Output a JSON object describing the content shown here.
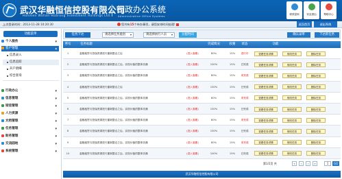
{
  "header": {
    "company_cn": "武汉华融恒信控股有限公司",
    "company_en": "Hanmen Wuhan Huarong Investment Holdings Ltd.",
    "system_cn": "行政办公系统",
    "system_en": "Administrative Office Systems",
    "buttons": [
      {
        "label": "修改密码",
        "icon": "key-icon"
      },
      {
        "label": "安全退出",
        "icon": "power-icon"
      },
      {
        "label": "帮助中心",
        "icon": "help-icon"
      }
    ]
  },
  "statusbar": {
    "login_info": "上次登录时间：2013-11-28 10:20:30",
    "notice_prefix": "您共有",
    "notice_count": "15",
    "notice_suffix": "个待办事项，请您安排时间处理!",
    "home_label": "返回首页",
    "exit_label": "退出系统"
  },
  "sidebar": {
    "heading": "功能菜单",
    "items": [
      {
        "label": "个人服务",
        "color": "#2f8bd6"
      },
      {
        "label": "客户管理",
        "color": "#e6a124",
        "expanded": true
      },
      {
        "label": "行政办公",
        "color": "#3c9a4a"
      },
      {
        "label": "信息管理",
        "color": "#2f8bd6"
      },
      {
        "label": "短信管理",
        "color": "#3c9a4a"
      },
      {
        "label": "人力资源",
        "color": "#e6a124"
      },
      {
        "label": "文档管理",
        "color": "#2f8bd6"
      },
      {
        "label": "任务管理",
        "color": "#3c9a4a"
      },
      {
        "label": "财务管理",
        "color": "#e34a3c"
      },
      {
        "label": "交流园地",
        "color": "#2f8bd6"
      },
      {
        "label": "系统管理",
        "color": "#e34a3c"
      }
    ],
    "sub_items": [
      "信息录入",
      "信息追踪",
      "开户明细",
      "综合查询"
    ]
  },
  "toolbar": {
    "title": "任务下达",
    "category_placeholder": "请选择任务类别",
    "person_placeholder": "请选择执行人员",
    "assign_label": "分配时间",
    "confirm_label": "确认录单",
    "next_label": "下达新任务"
  },
  "table": {
    "headers": [
      "序号",
      "任务标题",
      "完成情况",
      "权重",
      "状态",
      "功能"
    ],
    "urgent_tag": "(进入查看)",
    "actions": {
      "view": "查看任务详情",
      "edit": "修改任务",
      "delete": "删除任务"
    },
    "rows": [
      {
        "no": "1",
        "title": "金融租赁与担保资源进行重新整合之后",
        "progress": "80%",
        "weight": "15%",
        "status": "进行中",
        "status_type": "red"
      },
      {
        "no": "2",
        "title": "金融租赁与担保资源进行重新整合之后，实现价值的整体流通",
        "progress": "100%",
        "weight": "15%",
        "status": "已完成",
        "status_type": "gray"
      },
      {
        "no": "3",
        "title": "金融租赁与担保资源进行重新整合之后，实现价值的整体流通",
        "progress": "80%",
        "weight": "15%",
        "status": "未完成",
        "status_type": "red"
      },
      {
        "no": "4",
        "title": "金融租赁与担保资源进行重新整合之后",
        "progress": "100%",
        "weight": "15%",
        "status": "已完成",
        "status_type": "gray"
      },
      {
        "no": "5",
        "title": "金融租赁与担保资源进行重新整合之后，实现价值的整体流通",
        "progress": "80%",
        "weight": "15%",
        "status": "未完成",
        "status_type": "red"
      },
      {
        "no": "6",
        "title": "金融租赁与担保资源进行重新整合之后，实现价值的整体流通",
        "progress": "100%",
        "weight": "15%",
        "status": "已完成",
        "status_type": "gray"
      },
      {
        "no": "7",
        "title": "金融租赁与担保资源进行重新整合之后，实现价值的整体流通",
        "progress": "80%",
        "weight": "15%",
        "status": "未完成",
        "status_type": "red"
      },
      {
        "no": "8",
        "title": "金融租赁与担保资源进行重新整合之后，实现价值的整体流通",
        "progress": "100%",
        "weight": "15%",
        "status": "已完成",
        "status_type": "gray"
      },
      {
        "no": "9",
        "title": "金融租赁与担保资源进行重新整合之后，实现价值的整体流通",
        "progress": "80%",
        "weight": "15%",
        "status": "未完成",
        "status_type": "red"
      },
      {
        "no": "10",
        "title": "金融租赁与担保资源进行重新整合之后，实现价值的整体流通",
        "progress": "100%",
        "weight": "15%",
        "status": "已完成",
        "status_type": "gray"
      }
    ]
  },
  "pager": {
    "info": "第1/2页 共",
    "input_value": "1",
    "go_label": "GO"
  },
  "footer": {
    "text": "武汉华融恒信控股有限公司"
  }
}
